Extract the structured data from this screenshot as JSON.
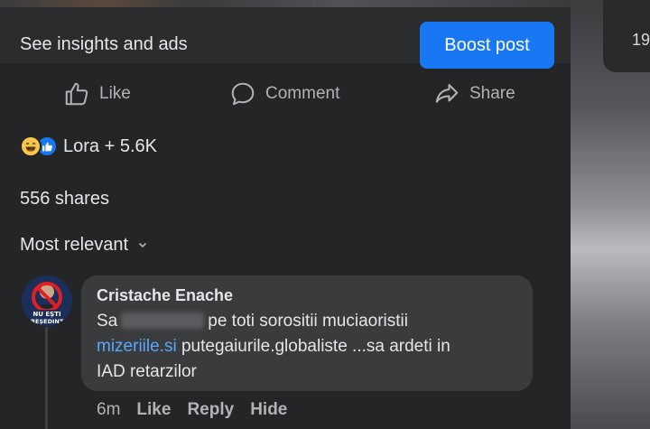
{
  "right_peek": {
    "number": "19"
  },
  "insights": {
    "label": "See insights and ads",
    "boost_label": "Boost post"
  },
  "actions": {
    "like": {
      "label": "Like",
      "icon": "thumbs-up-icon"
    },
    "comment": {
      "label": "Comment",
      "icon": "comment-icon"
    },
    "share": {
      "label": "Share",
      "icon": "share-icon"
    }
  },
  "reactions": {
    "icons": [
      "haha-reaction-icon",
      "like-reaction-icon"
    ],
    "text": "Lora + 5.6K"
  },
  "shares_text": "556 shares",
  "sort": {
    "label": "Most relevant",
    "icon": "chevron-down-icon"
  },
  "comment": {
    "author": "Cristache Enache",
    "avatar_text": "NU EȘTI PREȘEDINTE",
    "line1_start": "Sa",
    "line1_end": "pe toti sorositii muciaoristii",
    "line2_link": "mizeriile.si",
    "line2_rest": " putegaiurile.globaliste ...sa ardeti in",
    "line3": "IAD retarzilor",
    "time": "6m",
    "like_label": "Like",
    "reply_label": "Reply",
    "hide_label": "Hide"
  },
  "colors": {
    "accent": "#1877f2",
    "link": "#5aa7ff",
    "background": "#242526",
    "bubble": "#3a3b3c"
  }
}
